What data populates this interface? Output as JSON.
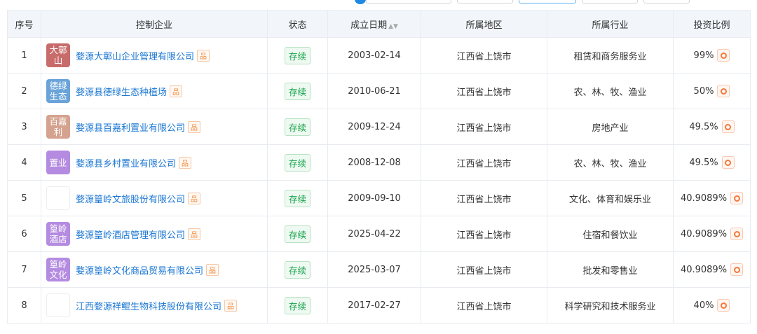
{
  "headers": {
    "index": "序号",
    "company": "控制企业",
    "status": "状态",
    "date": "成立日期",
    "region": "所属地区",
    "industry": "所属行业",
    "ratio": "投资比例"
  },
  "tag_label": "品",
  "rows": [
    {
      "index": "1",
      "logo_text": "大鄣山",
      "logo_color": "#c86b6b",
      "name": "婺源大鄣山企业管理有限公司",
      "status": "存续",
      "date": "2003-02-14",
      "region": "江西省上饶市",
      "industry": "租赁和商务服务业",
      "ratio": "99%"
    },
    {
      "index": "2",
      "logo_text": "德绿生态",
      "logo_color": "#6aa3d8",
      "name": "婺源县德绿生态种植场",
      "status": "存续",
      "date": "2010-06-21",
      "region": "江西省上饶市",
      "industry": "农、林、牧、渔业",
      "ratio": "50%"
    },
    {
      "index": "3",
      "logo_text": "百嘉利",
      "logo_color": "#d4a28e",
      "name": "婺源县百嘉利置业有限公司",
      "status": "存续",
      "date": "2009-12-24",
      "region": "江西省上饶市",
      "industry": "房地产业",
      "ratio": "49.5%"
    },
    {
      "index": "4",
      "logo_text": "置业",
      "logo_color": "#b48be0",
      "name": "婺源县乡村置业有限公司",
      "status": "存续",
      "date": "2008-12-08",
      "region": "江西省上饶市",
      "industry": "农、林、牧、渔业",
      "ratio": "49.5%"
    },
    {
      "index": "5",
      "logo_text": "",
      "logo_color": "#ffffff",
      "name": "婺源篁岭文旅股份有限公司",
      "status": "存续",
      "date": "2009-09-10",
      "region": "江西省上饶市",
      "industry": "文化、体育和娱乐业",
      "ratio": "40.9089%"
    },
    {
      "index": "6",
      "logo_text": "篁岭酒店",
      "logo_color": "#b48be0",
      "name": "婺源篁岭酒店管理有限公司",
      "status": "存续",
      "date": "2025-04-22",
      "region": "江西省上饶市",
      "industry": "住宿和餐饮业",
      "ratio": "40.9089%"
    },
    {
      "index": "7",
      "logo_text": "篁岭文化",
      "logo_color": "#b48be0",
      "name": "婺源篁岭文化商品贸易有限公司",
      "status": "存续",
      "date": "2025-03-07",
      "region": "江西省上饶市",
      "industry": "批发和零售业",
      "ratio": "40.9089%"
    },
    {
      "index": "8",
      "logo_text": "",
      "logo_color": "#ffffff",
      "name": "江西婺源祥鲲生物科技股份有限公司",
      "status": "存续",
      "date": "2017-02-27",
      "region": "江西省上饶市",
      "industry": "科学研究和技术服务业",
      "ratio": "40%"
    }
  ]
}
